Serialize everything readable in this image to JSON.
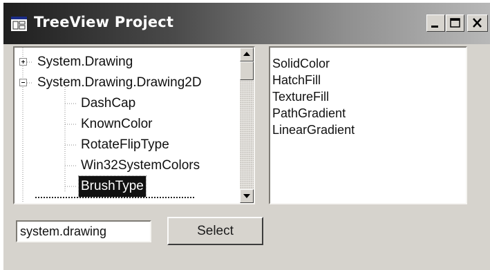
{
  "window": {
    "title": "TreeView Project",
    "icon": "form-window-icon",
    "controls": [
      "minimize-icon",
      "maximize-icon",
      "close-icon"
    ]
  },
  "tree": {
    "nodes": [
      {
        "label": "System.Drawing",
        "expander": "plus",
        "level": 0
      },
      {
        "label": "System.Drawing.Drawing2D",
        "expander": "minus",
        "level": 0
      },
      {
        "label": "DashCap",
        "level": 1
      },
      {
        "label": "KnownColor",
        "level": 1
      },
      {
        "label": "RotateFlipType",
        "level": 1
      },
      {
        "label": "Win32SystemColors",
        "level": 1
      },
      {
        "label": "BrushType",
        "level": 1,
        "selected": true
      }
    ],
    "scrollbar": {
      "up": "scroll-up-arrow-icon",
      "down": "scroll-down-arrow-icon"
    }
  },
  "list": {
    "items": [
      "SolidColor",
      "HatchFill",
      "TextureFill",
      "PathGradient",
      "LinearGradient"
    ]
  },
  "input": {
    "value": "system.drawing"
  },
  "select_button": {
    "label": "Select"
  },
  "colors": {
    "window_face": "#d6d3cd",
    "selection": "#111111",
    "title_start": "#1f1f1f",
    "title_end": "#b8b8b8"
  }
}
